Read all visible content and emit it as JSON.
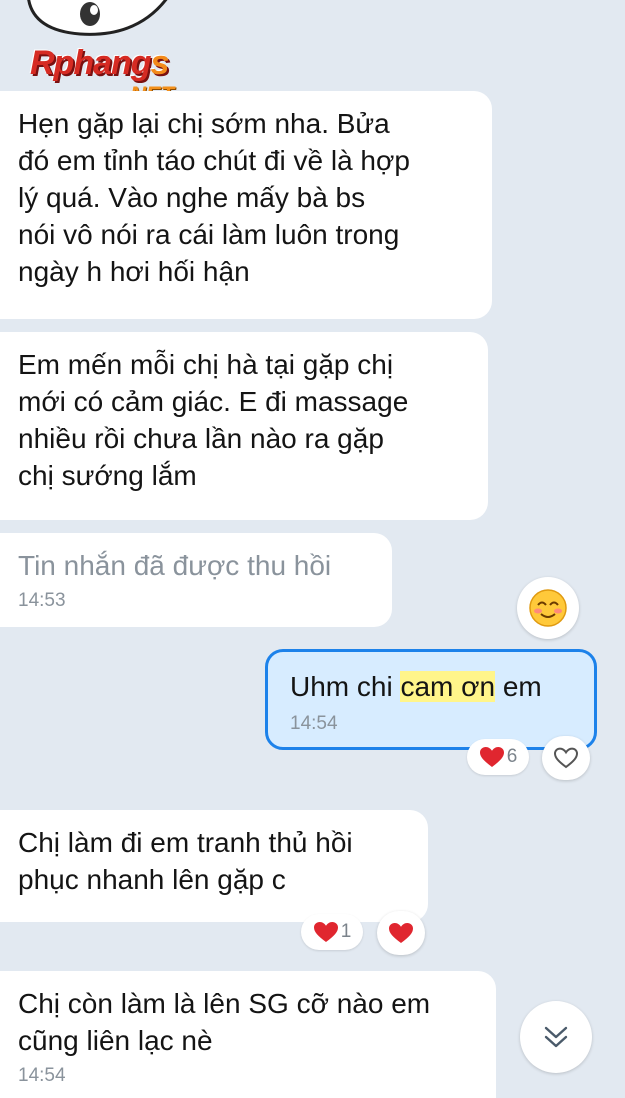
{
  "logo": {
    "main": "Rphang",
    "suffix": "s",
    "net": ".NET"
  },
  "messages": {
    "m1": {
      "text": "Hẹn gặp lại chị sớm nha. Bửa\nđó em tỉnh táo chút đi về là hợp\nlý quá. Vào nghe mấy bà bs\nnói vô nói ra cái làm luôn trong\nngày h hơi hối hận"
    },
    "m2": {
      "text": "Em mến mỗi chị hà tại gặp chị\nmới có cảm giác. E đi massage\nnhiều rồi chưa lần nào ra gặp\nchị sướng lắm"
    },
    "m3": {
      "text": "Tin nhắn đã được thu hồi",
      "time": "14:53"
    },
    "m4": {
      "text_before": "Uhm chi ",
      "text_highlight": "cam ơn",
      "text_after": " em",
      "time": "14:54",
      "reaction_count": "6"
    },
    "m5": {
      "text": "Chị làm đi em tranh thủ hồi\nphục nhanh lên gặp c",
      "reaction_count": "1"
    },
    "m6": {
      "text": "Chị còn làm là lên SG cỡ nào em\ncũng liên lạc nè",
      "time": "14:54"
    }
  },
  "colors": {
    "background": "#e2e9f1",
    "sent_bubble": "#d7ecff",
    "sent_border": "#1d82ea",
    "highlight": "#fff58a",
    "heart": "#e0262f"
  },
  "icons": {
    "emoji": "smiling-blush-emoji",
    "heart": "heart-icon",
    "heart_outline": "heart-outline-icon",
    "scroll_down": "double-chevron-down-icon"
  }
}
